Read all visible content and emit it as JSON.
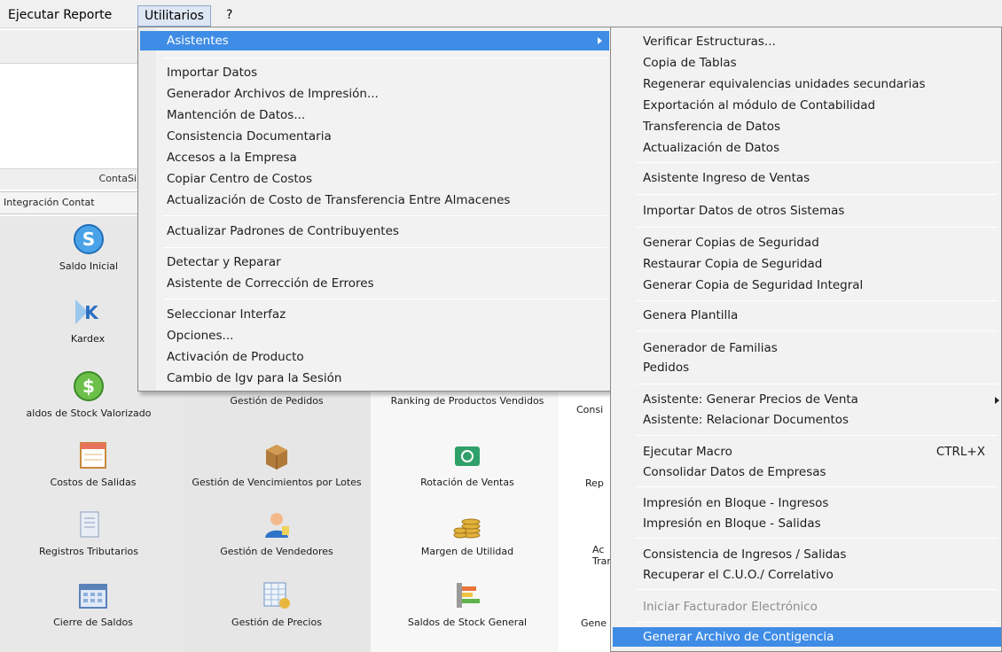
{
  "menubar": {
    "items": [
      "Ejecutar Reporte",
      "Utilitarios",
      "?"
    ]
  },
  "background": {
    "conta_label": "ContaSi",
    "integ_tab": "Integración Contat",
    "tiles": {
      "saldo_inicial": "Saldo Inicial",
      "kardex": "Kardex",
      "saldos_stock": "aldos de Stock Valorizado",
      "gestion_pedidos": "Gestión de Pedidos",
      "ranking": "Ranking de Productos Vendidos",
      "consi": "Consi",
      "costos_salidas": "Costos de Salidas",
      "venc_lotes": "Gestión de Vencimientos por Lotes",
      "rotacion": "Rotación de Ventas",
      "rep": "Rep",
      "registros": "Registros Tributarios",
      "vendedores": "Gestión de Vendedores",
      "margen": "Margen de Utilidad",
      "ac_tran": "Ac Tran",
      "cierre": "Cierre de Saldos",
      "precios": "Gestión de Precios",
      "saldos_general": "Saldos de Stock General",
      "gene": "Gene"
    }
  },
  "dropdown": {
    "items": [
      "Asistentes",
      "Importar Datos",
      "Generador Archivos de Impresión...",
      "Mantención de Datos...",
      "Consistencia Documentaria",
      "Accesos a la Empresa",
      "Copiar Centro de Costos",
      "Actualización de Costo de Transferencia Entre Almacenes",
      "Actualizar Padrones de Contribuyentes",
      "Detectar y Reparar",
      "Asistente de Corrección de Errores",
      "Seleccionar Interfaz",
      "Opciones...",
      "Activación de Producto",
      "Cambio de Igv para la Sesión"
    ]
  },
  "submenu": {
    "items": [
      "Verificar Estructuras...",
      "Copia de Tablas",
      "Regenerar equivalencias unidades secundarias",
      "Exportación al módulo de Contabilidad",
      "Transferencia de Datos",
      "Actualización de Datos",
      "Asistente Ingreso de Ventas",
      "Importar Datos de otros Sistemas",
      "Generar Copias de Seguridad",
      "Restaurar Copia de Seguridad",
      "Generar Copia de Seguridad Integral",
      "Genera Plantilla",
      "Generador de Familias",
      "Pedidos",
      "Asistente: Generar Precios de Venta",
      "Asistente: Relacionar Documentos",
      "Ejecutar Macro",
      "Consolidar Datos de Empresas",
      "Impresión en Bloque - Ingresos",
      "Impresión en Bloque - Salidas",
      "Consistencia de Ingresos / Salidas",
      "Recuperar el C.U.O./ Correlativo",
      "Iniciar Facturador Electrónico",
      "Generar Archivo de Contigencia"
    ],
    "shortcut_macro": "CTRL+X"
  },
  "colors": {
    "highlight": "#3f8ce6",
    "menu_bg": "#f2f2f2",
    "disabled": "#8d8d8d"
  }
}
